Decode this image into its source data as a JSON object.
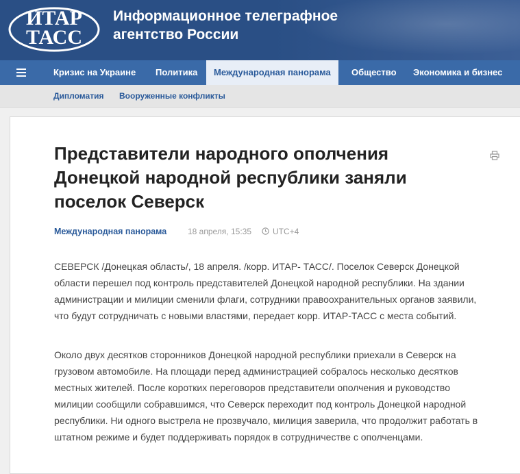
{
  "header": {
    "logo_line1": "ИТАР",
    "logo_line2": "ТАСС",
    "brand_line1": "Информационное телеграфное",
    "brand_line2": "агентство России"
  },
  "nav": {
    "menu_icon": "hamburger-icon",
    "items": [
      {
        "label": "Кризис на Украине"
      },
      {
        "label": "Политика"
      },
      {
        "label": "Международная панорама",
        "active": true
      },
      {
        "label": "Общество"
      },
      {
        "label": "Экономика и бизнес"
      }
    ]
  },
  "subnav": {
    "items": [
      {
        "label": "Дипломатия"
      },
      {
        "label": "Вооруженные конфликты"
      }
    ]
  },
  "article": {
    "title": "Представители народного ополчения Донецкой народной республики заняли поселок Северск",
    "print_icon": "printer-icon",
    "rubric": "Международная панорама",
    "date": "18 апреля, 15:35",
    "timezone_icon": "clock-icon",
    "timezone": "UTC+4",
    "paragraphs": [
      "СЕВЕРСК /Донецкая область/, 18 апреля. /корр. ИТАР- ТАСС/. Поселок Северск Донецкой области перешел под контроль представителей Донецкой народной республики. На здании администрации и милиции сменили флаги, сотрудники правоохранительных органов заявили, что будут сотрудничать с новыми властями, передает корр. ИТАР-ТАСС с места событий.",
      "Около двух десятков сторонников Донецкой народной республики приехали в Северск на грузовом автомобиле. На площади перед администрацией собралось несколько десятков местных жителей. После коротких переговоров представители ополчения и руководство милиции сообщили собравшимся, что Северск переходит под контроль Донецкой народной республики. Ни одного выстрела не прозвучало, милиция заверила, что продолжит работать в штатном режиме и будет поддерживать порядок в сотрудничестве с ополченцами."
    ]
  },
  "colors": {
    "header": "#2a4f85",
    "nav": "#3a6aa8",
    "active_tab_bg": "#e8eef7",
    "link": "#2a5a9a"
  }
}
